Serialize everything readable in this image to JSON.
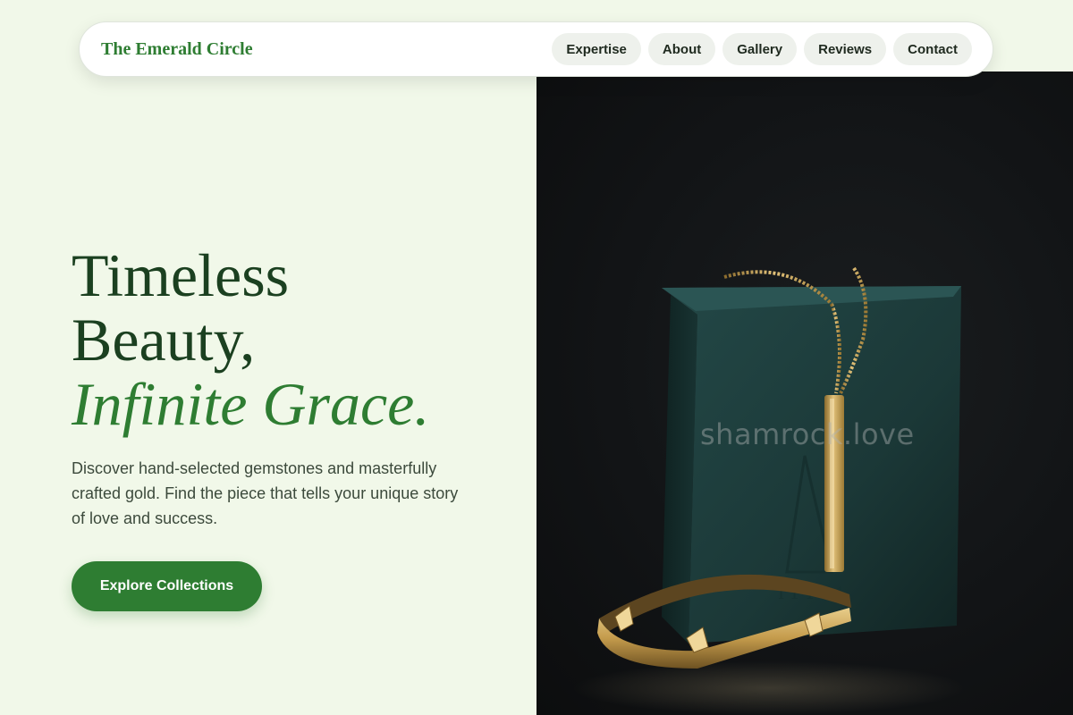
{
  "nav": {
    "brand": "The Emerald Circle",
    "links": [
      "Expertise",
      "About",
      "Gallery",
      "Reviews",
      "Contact"
    ]
  },
  "hero": {
    "headline_line1": "Timeless",
    "headline_line2": "Beauty,",
    "headline_accent": "Infinite Grace.",
    "description": "Discover hand-selected gemstones and masterfully crafted gold. Find the piece that tells your unique story of love and success.",
    "cta_label": "Explore Collections"
  },
  "photo": {
    "watermark": "shamrock.love",
    "subject": "gold bar pendant necklace and gold studded bangle on dark teal leather box"
  },
  "colors": {
    "page_background": "#f1f8e9",
    "brand_green": "#2e7d32",
    "headline_dark_green": "#1b4020",
    "photo_background": "#121416",
    "box_teal": "#1d3b3a",
    "gold": "#c9a14e"
  }
}
